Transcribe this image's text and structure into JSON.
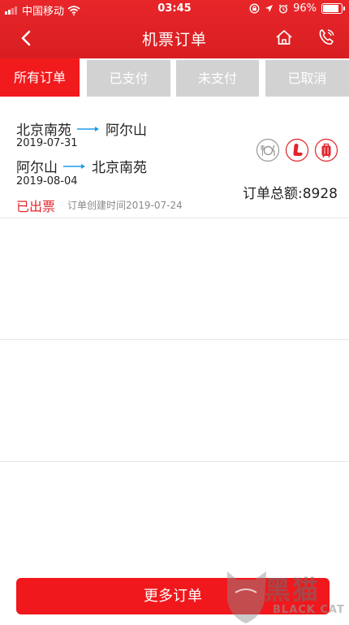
{
  "status_bar": {
    "carrier": "中国移动",
    "time": "03:45",
    "battery": "96%"
  },
  "header": {
    "title": "机票订单",
    "back_icon": "chevron-left-icon",
    "home_icon": "home-icon",
    "phone_icon": "phone-icon"
  },
  "tabs": [
    {
      "label": "所有订单",
      "active": true
    },
    {
      "label": "已支付",
      "active": false
    },
    {
      "label": "未支付",
      "active": false
    },
    {
      "label": "已取消",
      "active": false
    }
  ],
  "order": {
    "legs": [
      {
        "from": "北京南苑",
        "to": "阿尔山",
        "date": "2019-07-31"
      },
      {
        "from": "阿尔山",
        "to": "北京南苑",
        "date": "2019-08-04"
      }
    ],
    "services": [
      "meal-icon",
      "seat-icon",
      "luggage-icon"
    ],
    "total": "订单总额:8928",
    "status": "已出票",
    "created": "订单创建时间2019-07-24"
  },
  "footer": {
    "more_label": "更多订单"
  },
  "watermark": {
    "cn": "黑猫",
    "en": "BLACK CAT"
  },
  "colors": {
    "brand_red": "#e8262a",
    "tab_inactive": "#d2d2d2",
    "arrow_blue": "#1e9be8",
    "status_red": "#e3242b"
  }
}
